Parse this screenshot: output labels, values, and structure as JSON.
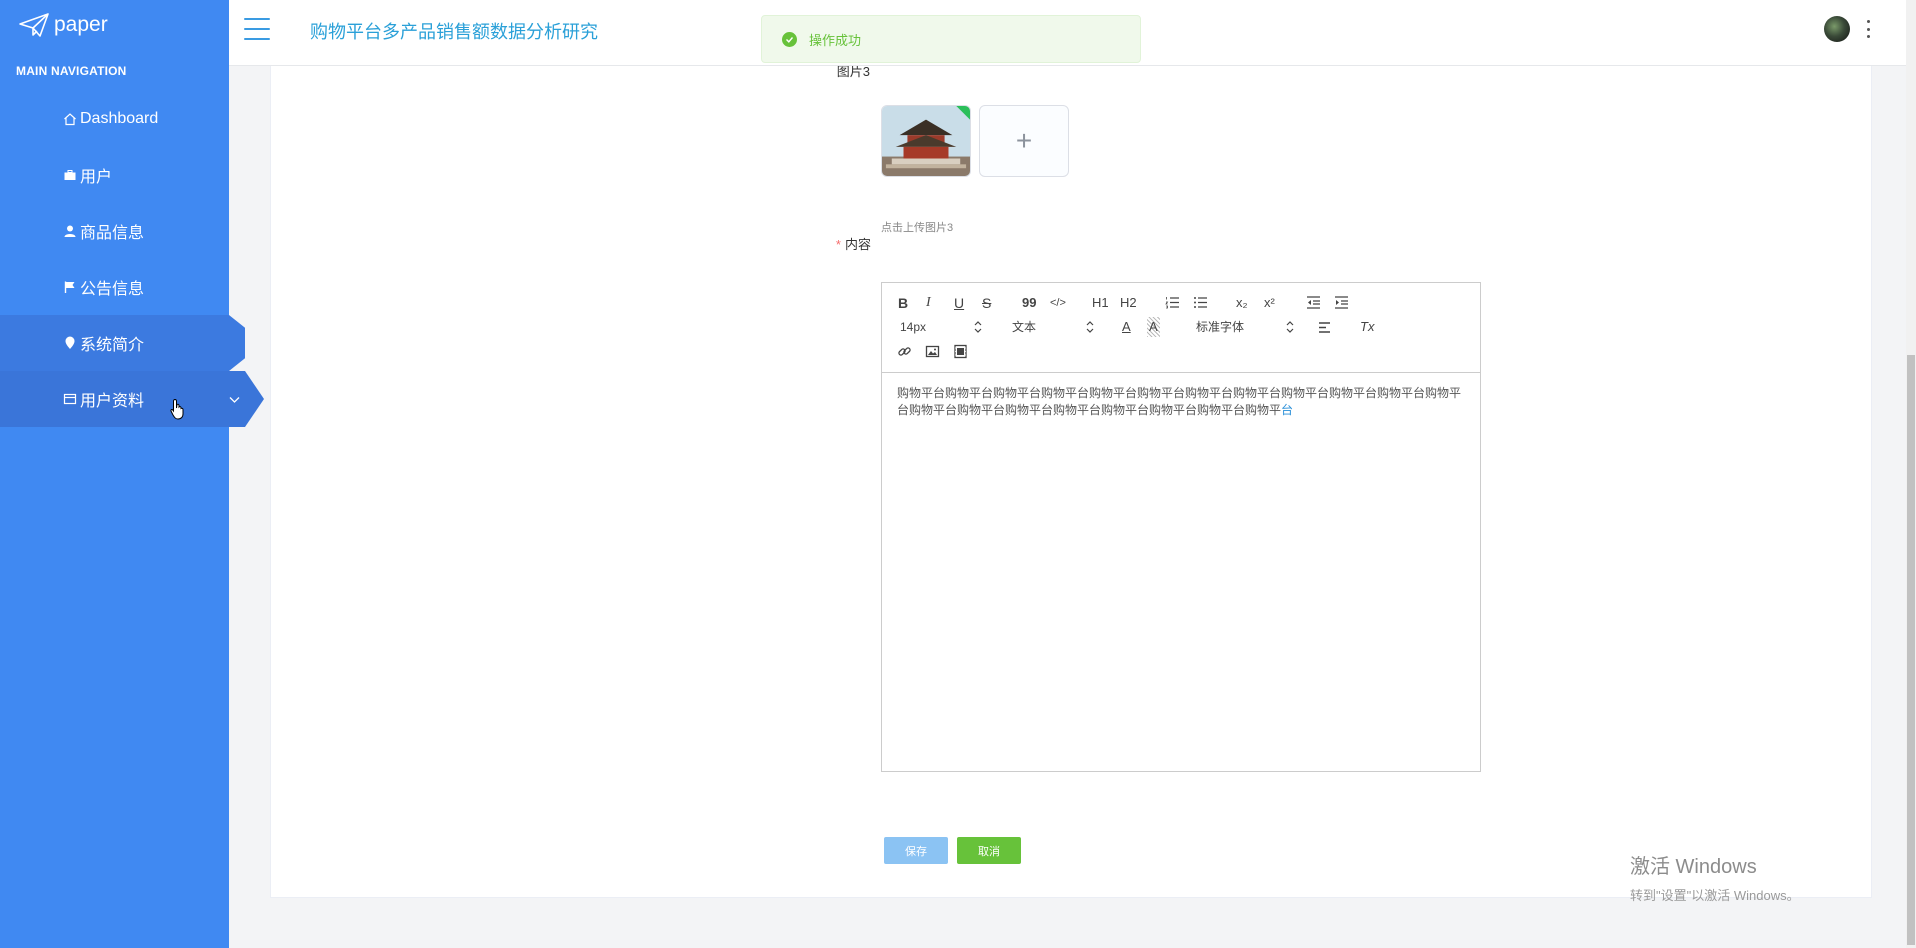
{
  "sidebar": {
    "logo_text": "paper",
    "nav_heading": "MAIN NAVIGATION",
    "items": [
      {
        "label": "Dashboard",
        "icon": "home-icon"
      },
      {
        "label": "用户",
        "icon": "briefcase-icon"
      },
      {
        "label": "商品信息",
        "icon": "user-icon"
      },
      {
        "label": "公告信息",
        "icon": "flag-icon"
      },
      {
        "label": "系统简介",
        "icon": "map-pin-icon"
      },
      {
        "label": "用户资料",
        "icon": "card-icon"
      }
    ]
  },
  "topbar": {
    "title": "购物平台多产品销售额数据分析研究"
  },
  "toast": {
    "message": "操作成功"
  },
  "form": {
    "image3_label": "图片3",
    "upload_hint": "点击上传图片3",
    "content_label": "内容",
    "required_mark": "*",
    "upload_plus": "+"
  },
  "editor": {
    "toolbar": {
      "bold": "B",
      "italic": "I",
      "underline": "U",
      "strike": "S",
      "blockquote": "99",
      "code": "</>",
      "h1": "H1",
      "h2": "H2",
      "subscript": "x₂",
      "superscript": "x²",
      "size_value": "14px",
      "header_value": "文本",
      "font_value": "标准字体",
      "color_letter": "A",
      "background_letter": "A",
      "clear": "Tx"
    },
    "content_main": "购物平台购物平台购物平台购物平台购物平台购物平台购物平台购物平台购物平台购物平台购物平台购物平台购物平台购物平台购物平台购物平台购物平台购物平台购物平台购物平",
    "content_tail": "台"
  },
  "buttons": {
    "save": "保存",
    "cancel": "取消"
  },
  "watermark": {
    "line1": "激活 Windows",
    "line2": "转到\"设置\"以激活 Windows。"
  },
  "colors": {
    "sidebar_bg": "#4089f2",
    "active_item_bg": "#3c7ae0",
    "title_color": "#2aa0d8",
    "toast_green": "#67c23a",
    "save_btn": "#8bc3f3"
  }
}
